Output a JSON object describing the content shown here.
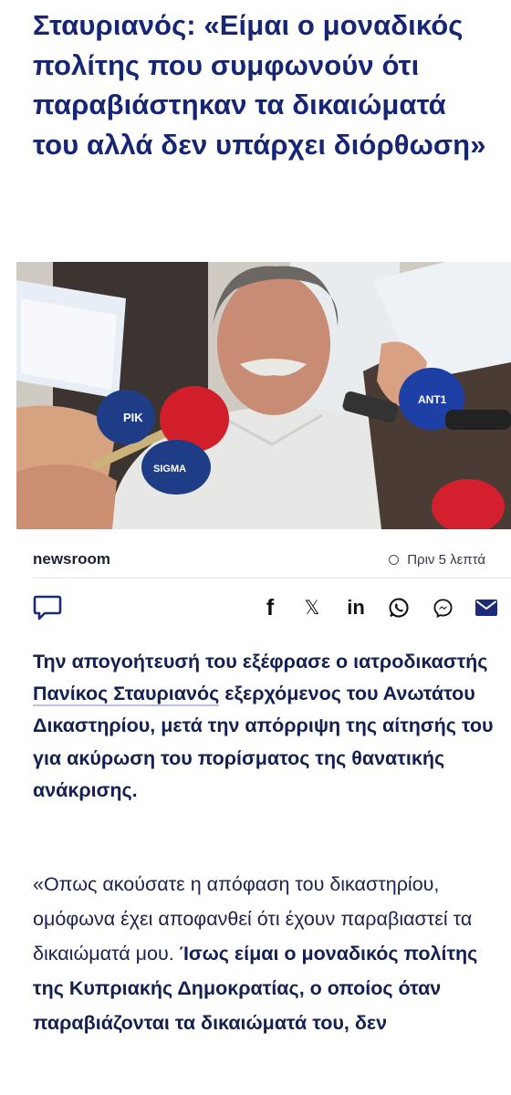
{
  "article": {
    "title": "Σταυριανός: «Είμαι ο μοναδικός πολίτης που συμφωνούν ότι παραβιάστηκαν τα δικαιώματά του αλλά δεν υπάρχει διόρθωση»",
    "author": "newsroom",
    "time_ago": "Πριν 5 λεπτά",
    "lead_before": "Την απογοήτευσή του εξέφρασε ο ιατροδικαστής ",
    "lead_link": "Πανίκος Σταυριανός",
    "lead_after": " εξερχόμενος του Ανωτάτου Δικαστηρίου, μετά την απόρριψη της αίτησής του για ακύρωση του πορίσματος της θανατικής ανάκρισης.",
    "body_normal": "«Οπως ακούσατε η απόφαση του δικαστηρίου, ομόφωνα έχει αποφανθεί ότι έχουν παραβιαστεί τα δικαιώματά μου. ",
    "body_bold": "Ίσως είμαι ο μοναδικός πολίτης της Κυπριακής Δημοκρατίας, ο οποίος όταν παραβιάζονται τα δικαιώματά του, δεν"
  },
  "hero_image": {
    "mic_labels": [
      "ΡΙΚ",
      "ΑΝΤ1",
      "SIGMA"
    ]
  },
  "share": {
    "icons": [
      "comment-icon",
      "facebook-icon",
      "x-icon",
      "linkedin-icon",
      "whatsapp-icon",
      "messenger-icon",
      "mail-icon"
    ],
    "facebook_glyph": "f",
    "x_glyph": "𝕏",
    "linkedin_glyph": "in"
  },
  "colors": {
    "title": "#162574",
    "accent": "#1c2b78",
    "link_underline": "#b9c0e2"
  }
}
